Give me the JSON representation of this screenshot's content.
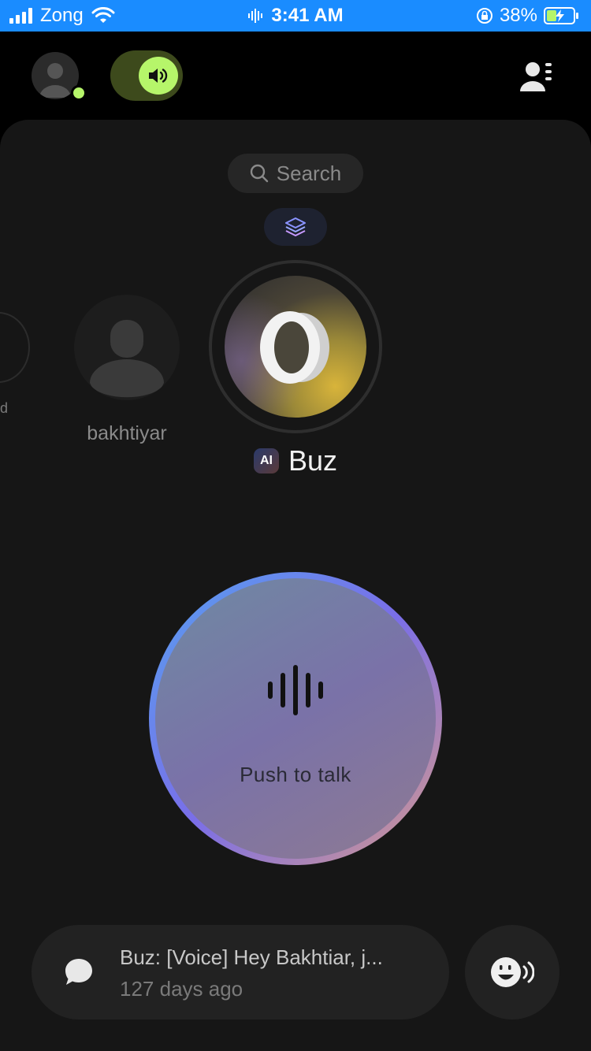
{
  "status_bar": {
    "carrier": "Zong",
    "time": "3:41 AM",
    "battery": "38%"
  },
  "top_bar": {
    "speaker_on": true
  },
  "search": {
    "label": "Search"
  },
  "contacts": [
    {
      "name": "d",
      "partial": true
    },
    {
      "name": "bakhtiyar"
    }
  ],
  "featured": {
    "badge": "AI",
    "name": "Buz"
  },
  "push_to_talk": {
    "label": "Push to talk"
  },
  "last_message": {
    "preview": "Buz: [Voice] Hey Bakhtiar, j...",
    "time": "127 days ago"
  },
  "colors": {
    "status_bar": "#1a8cff",
    "accent_green": "#b6f56a",
    "panel_bg": "#161616"
  }
}
